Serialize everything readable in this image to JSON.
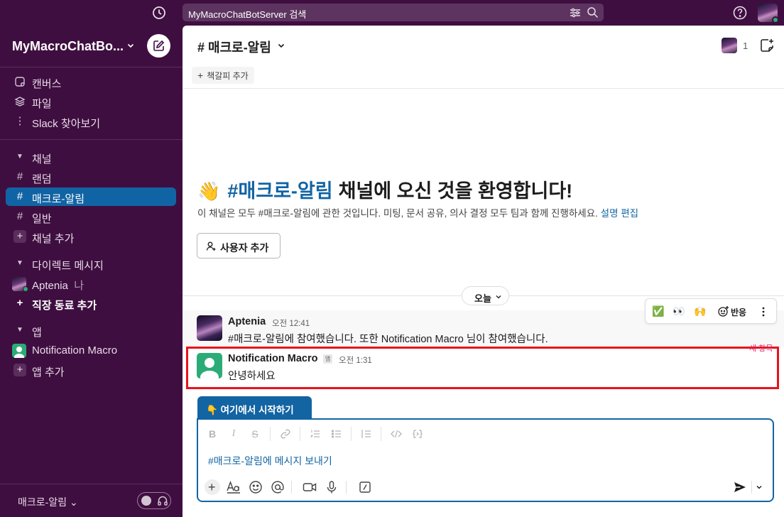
{
  "search": {
    "placeholder": "MyMacroChatBotServer 검색"
  },
  "workspace": {
    "name": "MyMacroChatBo..."
  },
  "sidebar": {
    "top_items": [
      {
        "label": "캔버스",
        "icon": "canvas-icon"
      },
      {
        "label": "파일",
        "icon": "files-icon"
      },
      {
        "label": "Slack 찾아보기",
        "icon": "more-vertical-icon"
      }
    ],
    "channels_header": "채널",
    "channels": [
      {
        "label": "랜덤",
        "active": false
      },
      {
        "label": "매크로-알림",
        "active": true
      },
      {
        "label": "일반",
        "active": false
      }
    ],
    "add_channel": "채널 추가",
    "dm_header": "다이렉트 메시지",
    "dms": [
      {
        "name": "Aptenia",
        "suffix": "나"
      }
    ],
    "add_coworker": "직장 동료 추가",
    "apps_header": "앱",
    "apps": [
      {
        "label": "Notification Macro"
      }
    ],
    "add_app": "앱 추가",
    "bottom_label": "매크로-알림"
  },
  "channel": {
    "title": "# 매크로-알림",
    "member_count": "1",
    "add_bookmark": "책갈피 추가"
  },
  "welcome": {
    "title_prefix": "#매크로-알림",
    "title_suffix": "채널에 오신 것을 환영합니다!",
    "description": "이 채널은 모두 #매크로-알림에 관한 것입니다. 미팅, 문서 공유, 의사 결정 모두 팀과 함께 진행하세요.",
    "edit_link": "설명 편집",
    "add_user_button": "사용자 추가"
  },
  "day_divider": "오늘",
  "messages": [
    {
      "author": "Aptenia",
      "time": "오전 12:41",
      "text": "#매크로-알림에 참여했습니다. 또한 Notification Macro 님이 참여했습니다."
    },
    {
      "author": "Notification Macro",
      "badge": "앱",
      "time": "오전 1:31",
      "text": "안녕하세요"
    }
  ],
  "hover_actions": {
    "react_label": "반응",
    "emojis": [
      "✅",
      "👀",
      "🙌"
    ]
  },
  "new_items_label": "새 항목",
  "composer": {
    "start_tab": "여기에서 시작하기",
    "start_tab_emoji": "👇",
    "placeholder": "#매크로-알림에 메시지 보내기"
  },
  "colors": {
    "sidebar_bg": "#3f0e40",
    "active_item": "#1164a3",
    "link": "#1264a3",
    "highlight_border": "#e8121b"
  }
}
